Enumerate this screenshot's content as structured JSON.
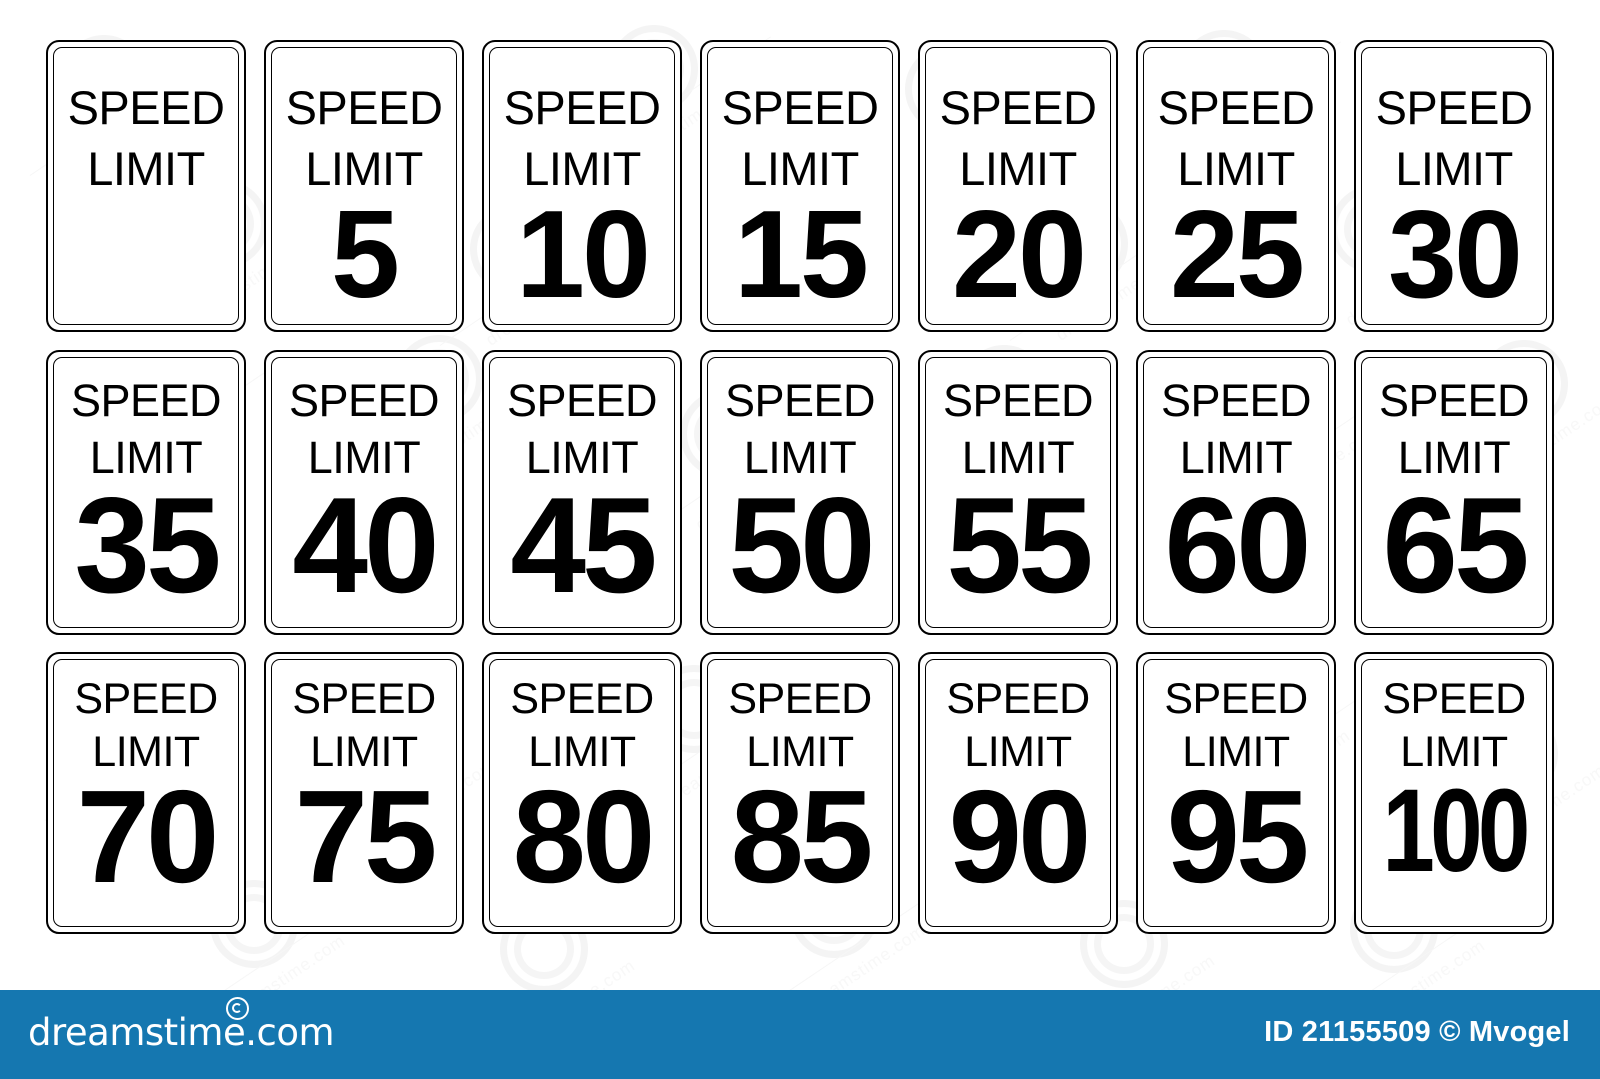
{
  "page": {
    "background_color": "#ffffff",
    "sign_label_line1": "SPEED",
    "sign_label_line2": "LIMIT",
    "sign_border_color": "#000000",
    "sign_face_color": "#ffffff"
  },
  "signs": {
    "rows": [
      {
        "row_index": 1,
        "items": [
          {
            "speed": "SPEED",
            "limit": "LIMIT",
            "value": ""
          },
          {
            "speed": "SPEED",
            "limit": "LIMIT",
            "value": "5"
          },
          {
            "speed": "SPEED",
            "limit": "LIMIT",
            "value": "10"
          },
          {
            "speed": "SPEED",
            "limit": "LIMIT",
            "value": "15"
          },
          {
            "speed": "SPEED",
            "limit": "LIMIT",
            "value": "20"
          },
          {
            "speed": "SPEED",
            "limit": "LIMIT",
            "value": "25"
          },
          {
            "speed": "SPEED",
            "limit": "LIMIT",
            "value": "30"
          }
        ]
      },
      {
        "row_index": 2,
        "items": [
          {
            "speed": "SPEED",
            "limit": "LIMIT",
            "value": "35"
          },
          {
            "speed": "SPEED",
            "limit": "LIMIT",
            "value": "40"
          },
          {
            "speed": "SPEED",
            "limit": "LIMIT",
            "value": "45"
          },
          {
            "speed": "SPEED",
            "limit": "LIMIT",
            "value": "50"
          },
          {
            "speed": "SPEED",
            "limit": "LIMIT",
            "value": "55"
          },
          {
            "speed": "SPEED",
            "limit": "LIMIT",
            "value": "60"
          },
          {
            "speed": "SPEED",
            "limit": "LIMIT",
            "value": "65"
          }
        ]
      },
      {
        "row_index": 3,
        "items": [
          {
            "speed": "SPEED",
            "limit": "LIMIT",
            "value": "70"
          },
          {
            "speed": "SPEED",
            "limit": "LIMIT",
            "value": "75"
          },
          {
            "speed": "SPEED",
            "limit": "LIMIT",
            "value": "80"
          },
          {
            "speed": "SPEED",
            "limit": "LIMIT",
            "value": "85"
          },
          {
            "speed": "SPEED",
            "limit": "LIMIT",
            "value": "90"
          },
          {
            "speed": "SPEED",
            "limit": "LIMIT",
            "value": "95"
          },
          {
            "speed": "SPEED",
            "limit": "LIMIT",
            "value": "100"
          }
        ]
      }
    ]
  },
  "footer": {
    "background_color": "#1577b0",
    "text_color": "#ffffff",
    "brand": "dreamstime.com",
    "credit": "ID 21155509 © Mvogel"
  },
  "watermark": {
    "text": "dreamstime.com"
  }
}
